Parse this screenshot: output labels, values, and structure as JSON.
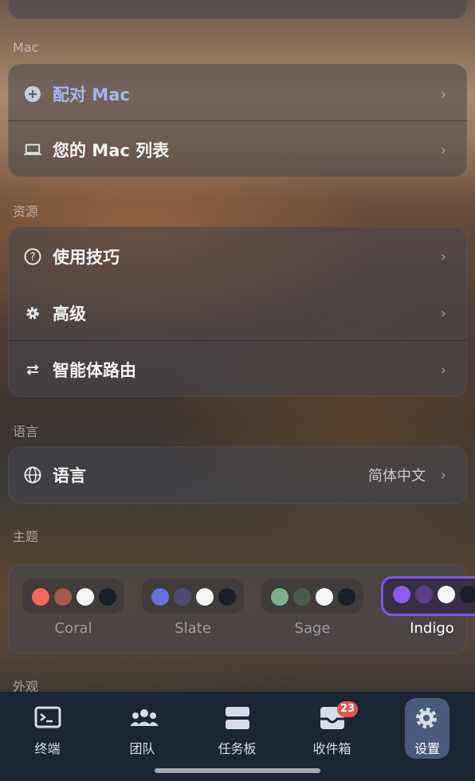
{
  "sections": {
    "mac": "Mac",
    "resources": "资源",
    "language": "语言",
    "theme": "主题",
    "appearance": "外观"
  },
  "mac_card": {
    "pair_mac": "配对 Mac",
    "mac_list": "您的 Mac 列表"
  },
  "resources_card": {
    "tips": "使用技巧",
    "advanced": "高级",
    "agent_routing": "智能体路由"
  },
  "language_card": {
    "label": "语言",
    "value": "简体中文"
  },
  "themes": [
    {
      "name": "Coral",
      "colors": [
        "#f0685a",
        "#a4584c",
        "#f4f5f7",
        "#1b1f2a"
      ],
      "selected": false
    },
    {
      "name": "Slate",
      "colors": [
        "#6a70d8",
        "#4b4a6e",
        "#f4f5f7",
        "#1b1f2a"
      ],
      "selected": false
    },
    {
      "name": "Sage",
      "colors": [
        "#7fb08e",
        "#4a5a4c",
        "#f4f5f7",
        "#1b1f2a"
      ],
      "selected": false
    },
    {
      "name": "Indigo",
      "colors": [
        "#8b5cf0",
        "#5a3f8a",
        "#f4f5f7",
        "#1b1f2a"
      ],
      "selected": true
    }
  ],
  "tabbar": {
    "terminal": "终端",
    "team": "团队",
    "taskboard": "任务板",
    "inbox": "收件箱",
    "inbox_badge": "23",
    "settings": "设置"
  },
  "colors": {
    "accent": "#7b57e6",
    "link": "#a9b3f0",
    "tabbar_bg": "#1c2533"
  }
}
